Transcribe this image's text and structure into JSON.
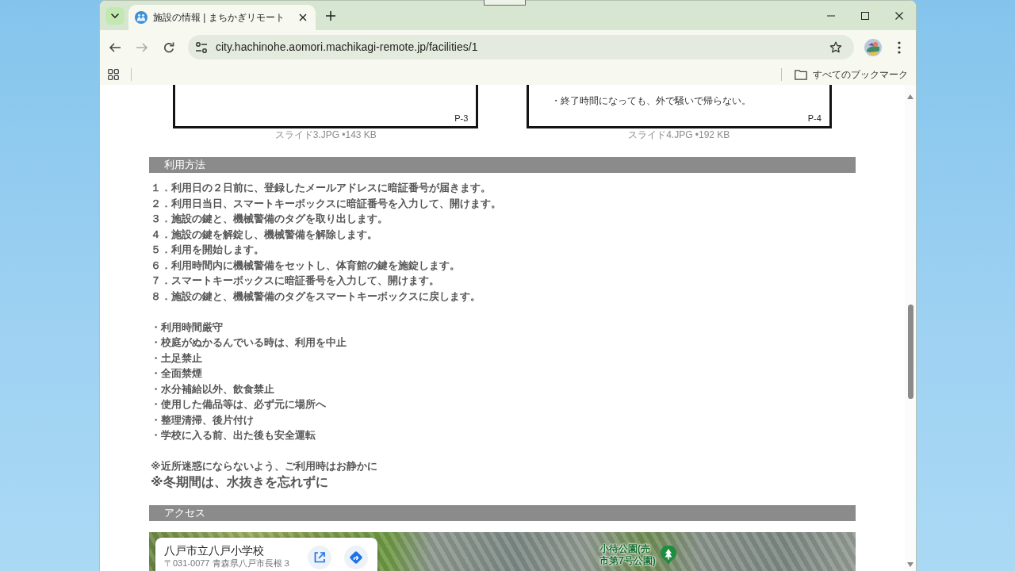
{
  "browser": {
    "tabs": [
      {
        "title": "施設の情報 | まちかぎリモート",
        "selected": true
      }
    ],
    "nav_buttons": [
      {
        "kind": "back",
        "disabled": false
      },
      {
        "kind": "forward",
        "disabled": true
      },
      {
        "kind": "reload",
        "disabled": false
      }
    ],
    "address": "city.hachinohe.aomori.machikagi-remote.jp/facilities/1",
    "bookmarks_folder": "すべてのブックマーク"
  },
  "slides": [
    {
      "page": "P-3",
      "caption": "スライド3.JPG •143 KB"
    },
    {
      "lines": [
        "・終了時間になっても、外で騒いで帰らない。"
      ],
      "page": "P-4",
      "caption": "スライド4.JPG •192 KB"
    }
  ],
  "usage": {
    "title": "利用方法",
    "steps": [
      "１．利用日の２日前に、登録したメールアドレスに暗証番号が届きます。",
      "２．利用日当日、スマートキーボックスに暗証番号を入力して、開けます。",
      "３．施設の鍵と、機械警備のタグを取り出します。",
      "４．施設の鍵を解錠し、機械警備を解除します。",
      "５．利用を開始します。",
      "６．利用時間内に機械警備をセットし、体育館の鍵を施錠します。",
      "７．スマートキーボックスに暗証番号を入力して、開けます。",
      "８．施設の鍵と、機械警備のタグをスマートキーボックスに戻します。"
    ],
    "rules": [
      "・利用時間厳守",
      "・校庭がぬかるんでいる時は、利用を中止",
      "・土足禁止",
      "・全面禁煙",
      "・水分補給以外、飲食禁止",
      "・使用した備品等は、必ず元に場所へ",
      "・整理清掃、後片付け",
      "・学校に入る前、出た後も安全運転"
    ],
    "notes": [
      {
        "text": "※近所迷惑にならないよう、ご利用時はお静かに",
        "emphasis": false
      },
      {
        "text": "※冬期間は、水抜きを忘れずに",
        "emphasis": true
      }
    ]
  },
  "access": {
    "title": "アクセス",
    "map": {
      "place_name": "八戸市立八戸小学校",
      "address": "〒031-0077 青森県八戸市長根３",
      "places": [
        {
          "label": "小待公園(売市第7号公園)"
        }
      ]
    }
  }
}
